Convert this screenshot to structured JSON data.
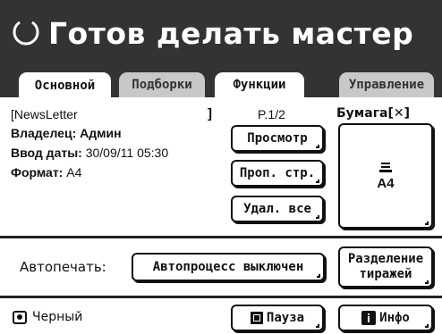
{
  "header": {
    "status_title": "Готов делать мастер",
    "status_icon": "circle-arc-icon"
  },
  "tabs": [
    {
      "label": "Основной",
      "active": true
    },
    {
      "label": "Подборки",
      "active": false
    },
    {
      "label": "Функции",
      "active": false
    },
    {
      "label": "Управление",
      "active": false
    }
  ],
  "document": {
    "name": "[NewsLetter",
    "name_close": "]",
    "owner_label": "Владелец:",
    "owner_value": "Админ",
    "date_label": "Ввод даты:",
    "date_value": "30/09/11  05:30",
    "format_label": "Формат:",
    "format_value": "A4"
  },
  "pager": {
    "indicator": "P.1/2",
    "preview_button": "Просмотр",
    "page_props_button": "Проп. стр.",
    "delete_all_button": "Удал. все"
  },
  "paper": {
    "label": "Бумага[✕]",
    "tray_icon": "paper-stack-icon",
    "size": "A4"
  },
  "autoprint": {
    "label": "Автопечать:",
    "button": "Автопроцесс выключен",
    "split_button_line1": "Разделение",
    "split_button_line2": "тиражей"
  },
  "footer": {
    "drum_icon": "drum-icon",
    "color_label": "Черный",
    "pause_button": "Пауза",
    "pause_icon": "square-icon",
    "info_button": "Инфо",
    "info_icon": "info-icon"
  }
}
